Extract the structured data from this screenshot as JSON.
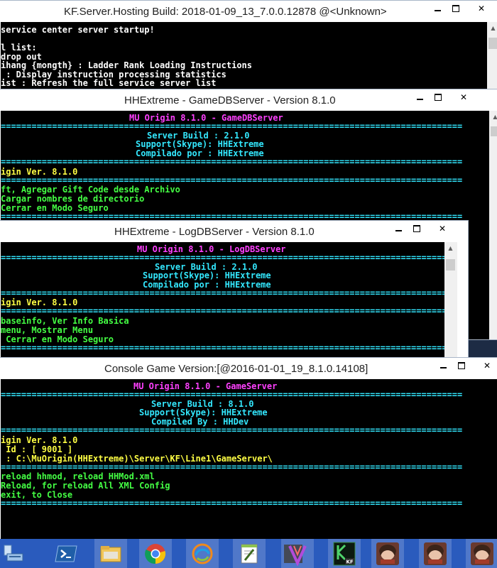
{
  "windows": {
    "kf": {
      "title": "KF.Server.Hosting Build: 2018-01-09_13_7.0.0.12878 @<Unknown>",
      "lines": [
        "service center server startup!",
        "",
        "l list:",
        "drop out",
        "ihang {mongth} : Ladder Rank Loading Instructions",
        " : Display instruction processing statistics",
        "ist : Refresh the full service server list"
      ]
    },
    "gamedb": {
      "title": "HHExtreme - GameDBServer - Version 8.1.0",
      "header": "MU Origin 8.1.0 - GameDBServer",
      "build": "Server Build : 2.1.0",
      "support": "Support(Skype): HHExtreme",
      "compiled": "Compilado por : HHExtreme",
      "ver": "igin Ver. 8.1.0",
      "cmds": [
        "ft, Agregar Gift Code desde Archivo",
        "Cargar nombres de directorio",
        "Cerrar en Modo Seguro"
      ]
    },
    "logdb": {
      "title": "HHExtreme - LogDBServer - Version 8.1.0",
      "header": "MU Origin 8.1.0 - LogDBServer",
      "build": "Server Build : 2.1.0",
      "support": "Support(Skype): HHExtreme",
      "compiled": "Compilado por : HHExtreme",
      "ver": "igin Ver. 8.1.0",
      "cmds": [
        "baseinfo, Ver Info Basica",
        "menu, Mostrar Menu",
        " Cerrar en Modo Seguro"
      ]
    },
    "game": {
      "title": "Console Game Version:[@2016-01-01_19_8.1.0.14108]",
      "header": "MU Origin 8.1.0 - GameServer",
      "build": "Server Build : 8.1.0",
      "support": "Support(Skype): HHExtreme",
      "compiled": "Compiled By : HHDev",
      "ver": "igin Ver. 8.1.0",
      "id": " Id : [ 9001 ]",
      "path": " : C:\\MuOrigin(HHExtreme)\\Server\\KF\\Line1\\GameServer\\",
      "cmds": [
        "reload hhmod, reload HHMod.xml",
        "Reload, for reload All XML Config",
        "exit, to Close"
      ]
    },
    "separator": "=========================================================================================="
  },
  "taskbar": {
    "items": [
      {
        "name": "server-manager-icon"
      },
      {
        "name": "powershell-icon"
      },
      {
        "name": "file-explorer-icon"
      },
      {
        "name": "chrome-icon"
      },
      {
        "name": "app-swirl-icon"
      },
      {
        "name": "notepad-plus-icon"
      },
      {
        "name": "app-dark-icon"
      },
      {
        "name": "app-v-icon"
      },
      {
        "name": "kf-server-icon"
      },
      {
        "name": "game-client-icon-1"
      },
      {
        "name": "game-client-icon-2"
      },
      {
        "name": "game-client-icon-3"
      }
    ]
  },
  "colors": {
    "console_bg": "#000000",
    "magenta": "#ff40ff",
    "cyan": "#33e8ff",
    "yellow": "#ffff44",
    "green": "#44ff44",
    "taskbar": "#2a5bbd"
  }
}
